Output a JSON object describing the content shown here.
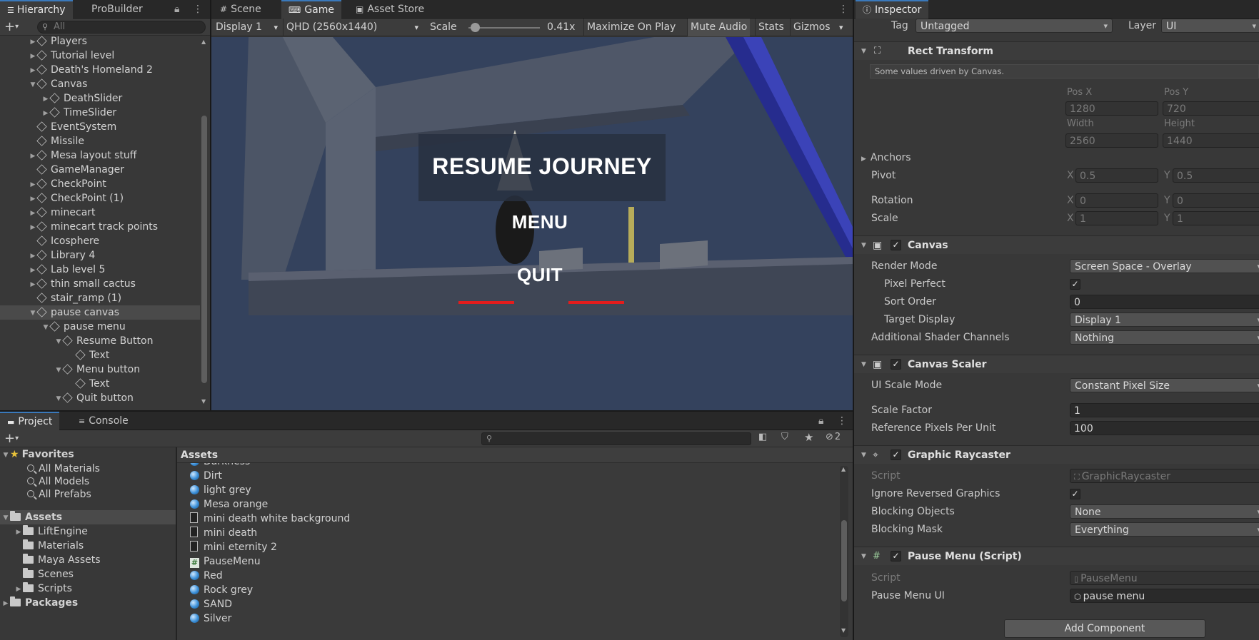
{
  "hierarchy": {
    "tabs": [
      "Hierarchy",
      "ProBuilder"
    ],
    "search_placeholder": "All",
    "rows": [
      {
        "label": "Players",
        "indent": 1,
        "arrow": "▶"
      },
      {
        "label": "Tutorial level",
        "indent": 1,
        "arrow": "▶"
      },
      {
        "label": "Death's Homeland 2",
        "indent": 1,
        "arrow": "▶"
      },
      {
        "label": "Canvas",
        "indent": 1,
        "arrow": "▼"
      },
      {
        "label": "DeathSlider",
        "indent": 2,
        "arrow": "▶"
      },
      {
        "label": "TimeSlider",
        "indent": 2,
        "arrow": "▶"
      },
      {
        "label": "EventSystem",
        "indent": 1,
        "arrow": ""
      },
      {
        "label": "Missile",
        "indent": 1,
        "arrow": ""
      },
      {
        "label": "Mesa layout stuff",
        "indent": 1,
        "arrow": "▶"
      },
      {
        "label": "GameManager",
        "indent": 1,
        "arrow": ""
      },
      {
        "label": "CheckPoint",
        "indent": 1,
        "arrow": "▶"
      },
      {
        "label": "CheckPoint (1)",
        "indent": 1,
        "arrow": "▶"
      },
      {
        "label": "minecart",
        "indent": 1,
        "arrow": "▶"
      },
      {
        "label": "minecart track points",
        "indent": 1,
        "arrow": "▶"
      },
      {
        "label": "Icosphere",
        "indent": 1,
        "arrow": ""
      },
      {
        "label": "Library 4",
        "indent": 1,
        "arrow": "▶"
      },
      {
        "label": "Lab level 5",
        "indent": 1,
        "arrow": "▶"
      },
      {
        "label": "thin small cactus",
        "indent": 1,
        "arrow": "▶"
      },
      {
        "label": "stair_ramp (1)",
        "indent": 1,
        "arrow": ""
      },
      {
        "label": "pause canvas",
        "indent": 1,
        "arrow": "▼",
        "selected": true
      },
      {
        "label": "pause menu",
        "indent": 2,
        "arrow": "▼"
      },
      {
        "label": "Resume Button",
        "indent": 3,
        "arrow": "▼"
      },
      {
        "label": "Text",
        "indent": 4,
        "arrow": ""
      },
      {
        "label": "Menu button",
        "indent": 3,
        "arrow": "▼"
      },
      {
        "label": "Text",
        "indent": 4,
        "arrow": ""
      },
      {
        "label": "Quit button",
        "indent": 3,
        "arrow": "▼"
      }
    ]
  },
  "game_view": {
    "tabs": [
      "Scene",
      "Game",
      "Asset Store"
    ],
    "display": "Display 1",
    "resolution": "QHD (2560x1440)",
    "scale_label": "Scale",
    "scale_value": "0.41x",
    "buttons": [
      "Maximize On Play",
      "Mute Audio",
      "Stats",
      "Gizmos"
    ],
    "menu": {
      "resume": "RESUME JOURNEY",
      "menu": "MENU",
      "quit": "QUIT"
    }
  },
  "project": {
    "tabs": [
      "Project",
      "Console"
    ],
    "hidden_count": "2",
    "favorites_label": "Favorites",
    "favorites": [
      "All Materials",
      "All Models",
      "All Prefabs"
    ],
    "assets_label": "Assets",
    "asset_folders": [
      "LiftEngine",
      "Materials",
      "Maya Assets",
      "Scenes",
      "Scripts"
    ],
    "packages_label": "Packages",
    "assets_header": "Assets",
    "asset_items": [
      {
        "label": "Darkness",
        "icon": "material-icon"
      },
      {
        "label": "Dirt",
        "icon": "material-icon"
      },
      {
        "label": "light grey",
        "icon": "material-icon"
      },
      {
        "label": "Mesa orange",
        "icon": "material-icon"
      },
      {
        "label": "mini death white background",
        "icon": "texture-icon"
      },
      {
        "label": "mini death",
        "icon": "texture-icon"
      },
      {
        "label": "mini eternity 2",
        "icon": "texture-icon"
      },
      {
        "label": "PauseMenu",
        "icon": "script-icon"
      },
      {
        "label": "Red",
        "icon": "material-icon"
      },
      {
        "label": "Rock grey",
        "icon": "material-icon"
      },
      {
        "label": "SAND",
        "icon": "material-icon"
      },
      {
        "label": "Silver",
        "icon": "material-icon"
      }
    ]
  },
  "inspector": {
    "title": "Inspector",
    "tag_label": "Tag",
    "tag_value": "Untagged",
    "layer_label": "Layer",
    "layer_value": "UI",
    "rect_transform": {
      "title": "Rect Transform",
      "note": "Some values driven by Canvas.",
      "pos_x_label": "Pos X",
      "pos_x": "1280",
      "pos_y_label": "Pos Y",
      "pos_y": "720",
      "width_label": "Width",
      "width": "2560",
      "height_label": "Height",
      "height": "1440",
      "anchors_label": "Anchors",
      "pivot_label": "Pivot",
      "pivot_x": "0.5",
      "pivot_y": "0.5",
      "rotation_label": "Rotation",
      "rotation_x": "0",
      "rotation_y": "0",
      "scale_label": "Scale",
      "scale_x": "1",
      "scale_y": "1",
      "x": "X",
      "y": "Y"
    },
    "canvas": {
      "title": "Canvas",
      "render_mode_label": "Render Mode",
      "render_mode": "Screen Space - Overlay",
      "pixel_perfect_label": "Pixel Perfect",
      "sort_order_label": "Sort Order",
      "sort_order": "0",
      "target_display_label": "Target Display",
      "target_display": "Display 1",
      "shader_channels_label": "Additional Shader Channels",
      "shader_channels": "Nothing"
    },
    "canvas_scaler": {
      "title": "Canvas Scaler",
      "ui_scale_label": "UI Scale Mode",
      "ui_scale": "Constant Pixel Size",
      "scale_factor_label": "Scale Factor",
      "scale_factor": "1",
      "ref_ppu_label": "Reference Pixels Per Unit",
      "ref_ppu": "100"
    },
    "graphic_raycaster": {
      "title": "Graphic Raycaster",
      "script_label": "Script",
      "script": "GraphicRaycaster",
      "ignore_reversed_label": "Ignore Reversed Graphics",
      "blocking_objects_label": "Blocking Objects",
      "blocking_objects": "None",
      "blocking_mask_label": "Blocking Mask",
      "blocking_mask": "Everything"
    },
    "pause_menu": {
      "title": "Pause Menu (Script)",
      "script_label": "Script",
      "script": "PauseMenu",
      "ui_label": "Pause Menu UI",
      "ui": "pause menu"
    },
    "add_component": "Add Component"
  }
}
